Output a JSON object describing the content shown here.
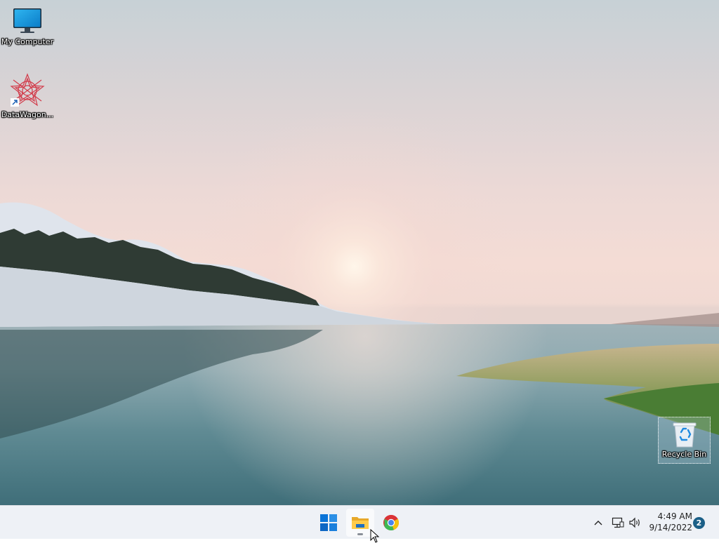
{
  "desktop": {
    "icons": [
      {
        "label": "My Computer",
        "icon": "monitor-icon"
      },
      {
        "label": "DataWagon...",
        "icon": "datawagon-shortcut-icon"
      },
      {
        "label": "Recycle Bin",
        "icon": "recycle-bin-icon"
      }
    ],
    "wallpaper": "lake-sunrise-landscape"
  },
  "taskbar": {
    "pinned": [
      {
        "name": "Start",
        "icon": "windows-start-icon"
      },
      {
        "name": "File Explorer",
        "icon": "folder-icon",
        "active": true
      },
      {
        "name": "Google Chrome",
        "icon": "chrome-icon"
      }
    ],
    "tray": {
      "chevron_icon": "chevron-up-icon",
      "network_icon": "network-icon",
      "volume_icon": "volume-icon",
      "time": "4:49 AM",
      "date": "9/14/2022",
      "notification_count": "2"
    }
  },
  "colors": {
    "taskbar_bg": "#eef1f6",
    "start_blue": "#0a74d8",
    "badge": "#1b5f87"
  }
}
